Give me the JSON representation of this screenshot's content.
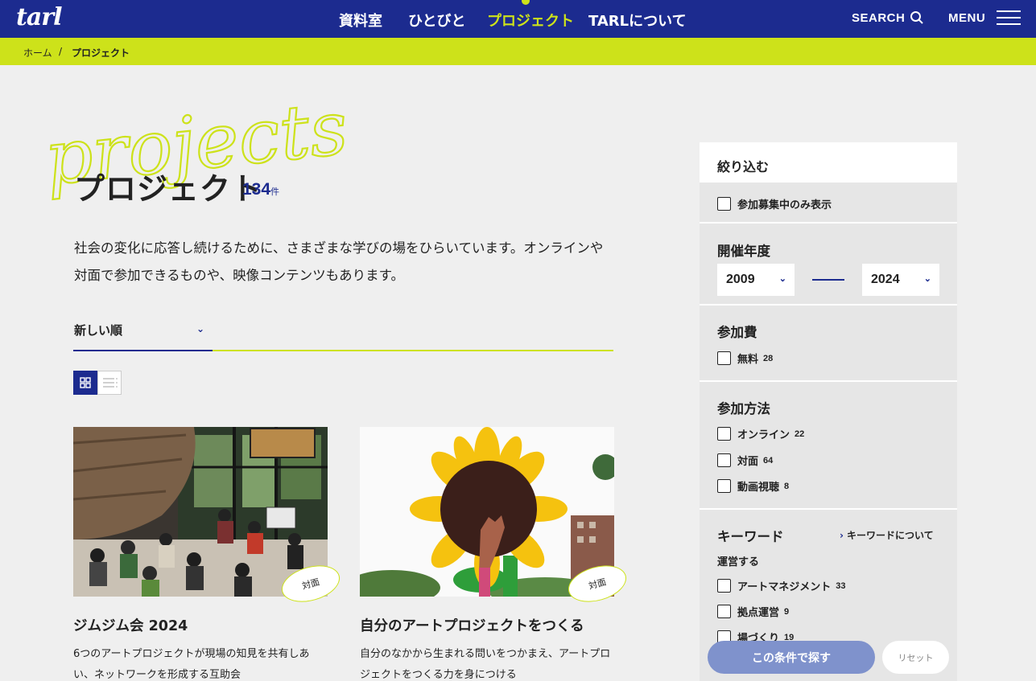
{
  "header": {
    "logo": "tarl",
    "nav": [
      "資料室",
      "ひとびと",
      "プロジェクト",
      "TARLについて"
    ],
    "search_label": "SEARCH",
    "menu_label": "MENU"
  },
  "breadcrumb": {
    "home": "ホーム",
    "separator": "/",
    "current": "プロジェクト"
  },
  "hero": {
    "script_word": "projects",
    "title": "プロジェクト",
    "count": "134",
    "count_unit": "件",
    "lead_line1": "社会の変化に応答し続けるために、さまざまな学びの場をひらいています。オンラインや",
    "lead_line2": "対面で参加できるものや、映像コンテンツもあります。"
  },
  "sort": {
    "selected": "新しい順"
  },
  "cards": [
    {
      "title": "ジムジム会 2024",
      "desc": "6つのアートプロジェクトが現場の知見を共有しあい、ネットワークを形成する互助会",
      "tag": "対面"
    },
    {
      "title": "自分のアートプロジェクトをつくる",
      "desc": "自分のなかから生まれる問いをつかまえ、アートプロジェクトをつくる力を身につける",
      "tag": "対面"
    }
  ],
  "filter": {
    "heading": "絞り込む",
    "recruiting_only": "参加募集中のみ表示",
    "year": {
      "title": "開催年度",
      "from": "2009",
      "to": "2024"
    },
    "fee": {
      "title": "参加費",
      "options": [
        {
          "label": "無料",
          "count": "28"
        }
      ]
    },
    "method": {
      "title": "参加方法",
      "options": [
        {
          "label": "オンライン",
          "count": "22"
        },
        {
          "label": "対面",
          "count": "64"
        },
        {
          "label": "動画視聴",
          "count": "8"
        }
      ]
    },
    "keyword": {
      "title": "キーワード",
      "about_link": "キーワードについて",
      "group": "運営する",
      "options": [
        {
          "label": "アートマネジメント",
          "count": "33"
        },
        {
          "label": "拠点運営",
          "count": "9"
        },
        {
          "label": "場づくり",
          "count": "19"
        }
      ]
    },
    "search_button": "この条件で探す",
    "reset_button": "リセット"
  },
  "colors": {
    "navy": "#1c2b8f",
    "lime": "#cde21a",
    "background": "#efefef"
  }
}
